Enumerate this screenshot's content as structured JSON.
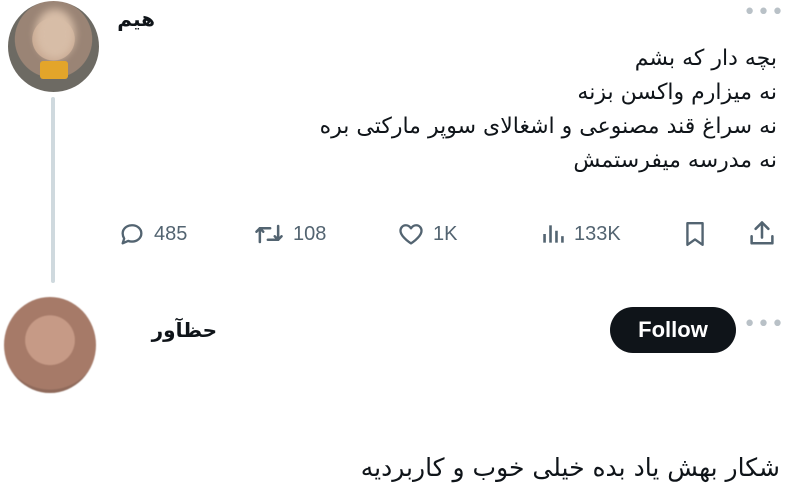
{
  "tweet": {
    "author": "هیم",
    "lines": [
      "بچه دار که بشم",
      "نه میزارم واکسن بزنه",
      "نه سراغ قند مصنوعی و اشغالای سوپر مارکتی بره",
      "نه مدرسه میفرستمش"
    ],
    "actions": {
      "reply": {
        "icon": "reply-icon",
        "count": "485"
      },
      "retweet": {
        "icon": "retweet-icon",
        "count": "108"
      },
      "like": {
        "icon": "heart-icon",
        "count": "1K"
      },
      "views": {
        "icon": "views-icon",
        "count": "133K"
      },
      "bookmark": {
        "icon": "bookmark-icon"
      },
      "share": {
        "icon": "share-icon"
      }
    }
  },
  "reply": {
    "author": "حظآور",
    "follow_label": "Follow",
    "text": "شکار بهش یاد بده خیلی خوب و کاربردیه"
  },
  "colors": {
    "text": "#0f1419",
    "muted": "#536471",
    "thread_line": "#cfd9de",
    "follow_bg": "#0f1419"
  }
}
